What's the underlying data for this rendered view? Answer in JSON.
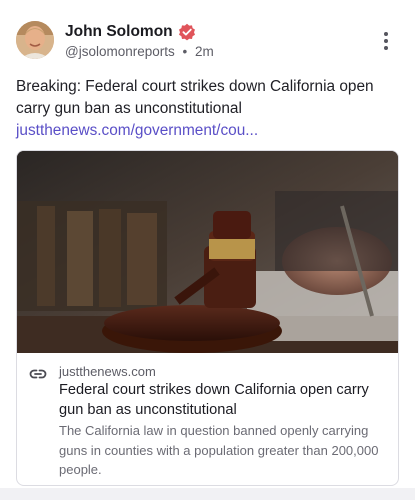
{
  "author": {
    "name": "John Solomon",
    "handle": "@jsolomonreports",
    "separator": "•",
    "time": "2m",
    "verified_color": "#e0545a"
  },
  "post": {
    "text": "Breaking: Federal court strikes down California open carry gun ban as unconstitutional ",
    "link_text": "justthenews.com/government/cou...",
    "link_color": "#5a4fc7"
  },
  "link_card": {
    "domain": "justthenews.com",
    "title": "Federal court strikes down California open carry gun ban as unconstitutional",
    "description": "The California law in question banned openly carrying guns in counties with a population greater than 200,000 people."
  },
  "icons": {
    "verified": "verified-badge-icon",
    "menu": "more-vertical-icon",
    "link": "link-icon"
  }
}
